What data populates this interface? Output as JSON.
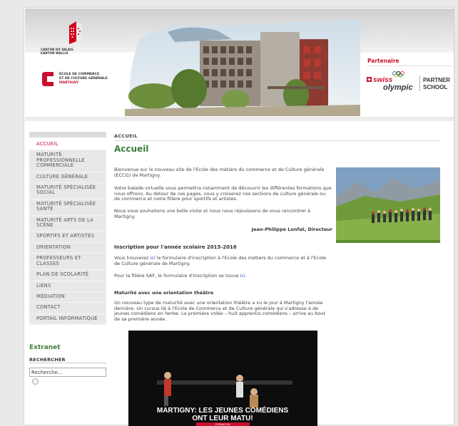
{
  "header": {
    "canton_line1": "CANTON DU VALAIS",
    "canton_line2": "KANTON WALLIS",
    "ecole_line1": "ÉCOLE DE COMMERCE",
    "ecole_line2": "ET DE CULTURE GÉNÉRALE",
    "ecole_line3": "MARTIGNY",
    "partner_label": "Partenaire",
    "swiss_text": "swiss",
    "olympic_text": "olympic",
    "partner_school_1": "PARTNER",
    "partner_school_2": "SCHOOL"
  },
  "nav": {
    "items": [
      {
        "label": "ACCUEIL"
      },
      {
        "label": "MATURITÉ PROFESSIONNELLE COMMERCIALE"
      },
      {
        "label": "CULTURE GÉNÉRALE"
      },
      {
        "label": "MATURITÉ SPÉCIALISÉE SOCIAL"
      },
      {
        "label": "MATURITÉ SPÉCIALISÉE SANTÉ"
      },
      {
        "label": "MATURITÉ ARTS DE LA SCÈNE"
      },
      {
        "label": "SPORTIFS ET ARTISTES"
      },
      {
        "label": "ORIENTATION"
      },
      {
        "label": "PROFESSEURS ET CLASSES"
      },
      {
        "label": "PLAN DE SCOLARITÉ"
      },
      {
        "label": "LIENS"
      },
      {
        "label": "MÉDIATION"
      },
      {
        "label": "CONTACT"
      },
      {
        "label": "PORTAIL INFORMATIQUE"
      }
    ]
  },
  "extranet": "Extranet",
  "search": {
    "heading": "RECHERCHER",
    "value": "Recherche..."
  },
  "content": {
    "breadcrumb": "ACCUEIL",
    "title": "Accueil",
    "p1": "Bienvenue sur le nouveau site de l'Ecole des métiers du commerce et de Culture générale (ECCG) de Martigny.",
    "p2": "Votre balade virtuelle vous permettra notamment de découvrir les différentes formations que nous offrons. Au détour de ces pages, vous y croiserez nos sections de culture générale ou de commerce et notre filière pour sportifs et artistes.",
    "p3": "Nous vous souhaitons une belle visite et nous nous réjouissons de vous rencontrer à Martigny.",
    "signature": "Jean-Philippe Lonfat, Directeur",
    "h_inscription": "Inscription pour l'année scolaire 2015-2016",
    "p4_a": "Vous trouverez ",
    "p4_link": "ici",
    "p4_b": " le formulaire d'inscription à l'Ecole des métiers du commerce et à l'Ecole de Culture générale de Martigny.",
    "p5_a": "Pour la filière SAF, le formulaire d'inscription se touve ",
    "p5_link": "ici",
    "p5_b": ".",
    "h_theatre": "Maturité avec une orientation théâtre",
    "p6": "Un nouveau type de maturité avec une orientation théâtre a vu le jour à Martigny l'année dernière. Un cursus lié à l'Ecole de Commerce et de Culture générale qui s'adresse à de jeunes comédiens en herbe. La première volée – huit apprentis comédiens – arrive au bout de sa première année.",
    "video_line1": "MARTIGNY: LES JEUNES COMÉDIENS",
    "video_line2": "ONT LEUR MATU!",
    "video_tag": "FORMATION"
  },
  "colors": {
    "accent_red": "#c8102e",
    "title_green": "#3c7f3a",
    "link_blue": "#2a5aa8"
  }
}
